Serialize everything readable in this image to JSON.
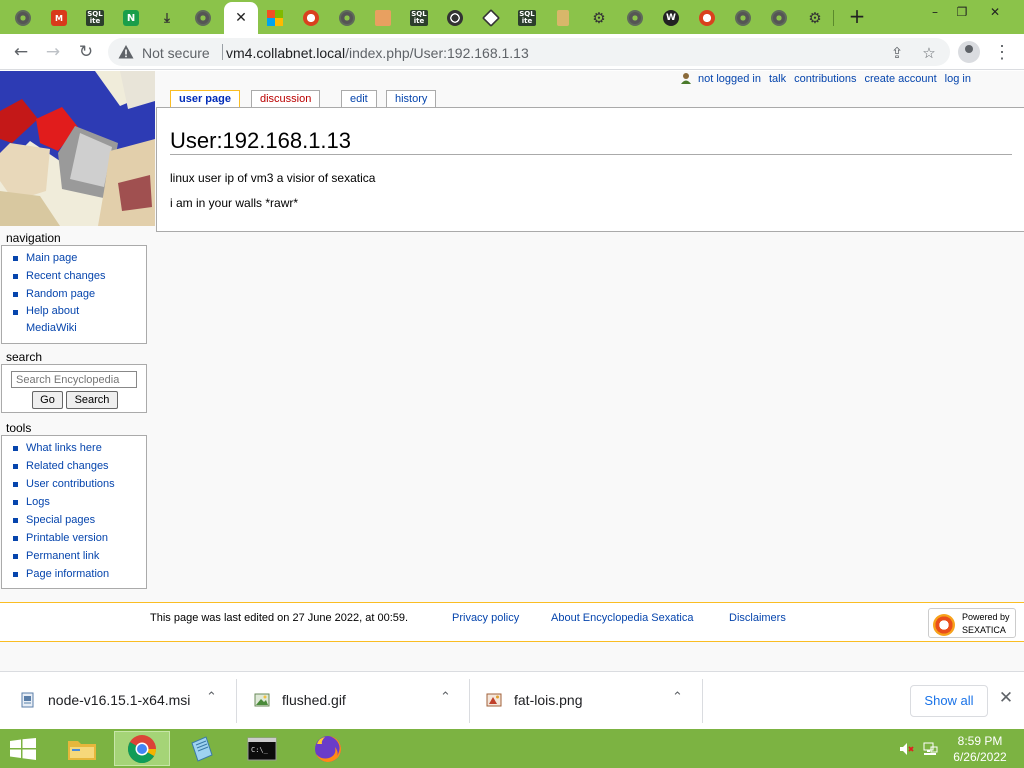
{
  "browser": {
    "active_tab_close": "✕",
    "new_tab": "+",
    "window_controls": {
      "minimize": "–",
      "restore": "❐",
      "close": "✕"
    },
    "nav": {
      "back": "←",
      "forward": "→",
      "reload": "↻"
    },
    "security_label": "Not secure",
    "url_host": "vm4.collabnet.local",
    "url_path": "/index.php/User:192.168.1.13"
  },
  "sidebar": {
    "navigation_heading": "navigation",
    "navigation_items": [
      "Main page",
      "Recent changes",
      "Random page",
      "Help about",
      "MediaWiki"
    ],
    "search_heading": "search",
    "search_placeholder": "Search Encyclopedia",
    "go_label": "Go",
    "search_label": "Search",
    "tools_heading": "tools",
    "tools_items": [
      "What links here",
      "Related changes",
      "User contributions",
      "Logs",
      "Special pages",
      "Printable version",
      "Permanent link",
      "Page information"
    ]
  },
  "personal": {
    "not_logged_in": "not logged in",
    "talk": "talk",
    "contributions": "contributions",
    "create_account": "create account",
    "log_in": "log in"
  },
  "content_tabs": {
    "user_page": "user page",
    "discussion": "discussion",
    "edit": "edit",
    "history": "history"
  },
  "page": {
    "title": "User:192.168.1.13",
    "line1": "linux user ip of vm3 a visior of sexatica",
    "line2": "i am in your walls *rawr*"
  },
  "footer": {
    "last_edited": "This page was last edited on 27 June 2022, at 00:59.",
    "privacy": "Privacy policy",
    "about": "About Encyclopedia Sexatica",
    "disclaimers": "Disclaimers",
    "powered_by": "Powered by",
    "powered_name": "SEXATICA"
  },
  "downloads": {
    "items": [
      "node-v16.15.1-x64.msi",
      "flushed.gif",
      "fat-lois.png"
    ],
    "chevron": "⌃",
    "show_all": "Show all",
    "close": "✕"
  },
  "taskbar": {
    "time": "8:59 PM",
    "date": "6/26/2022"
  },
  "colors": {
    "tabstrip": "#8bc34a",
    "taskbar": "#7cb342",
    "link": "#0645ad",
    "tab_accent": "#fabd23"
  }
}
